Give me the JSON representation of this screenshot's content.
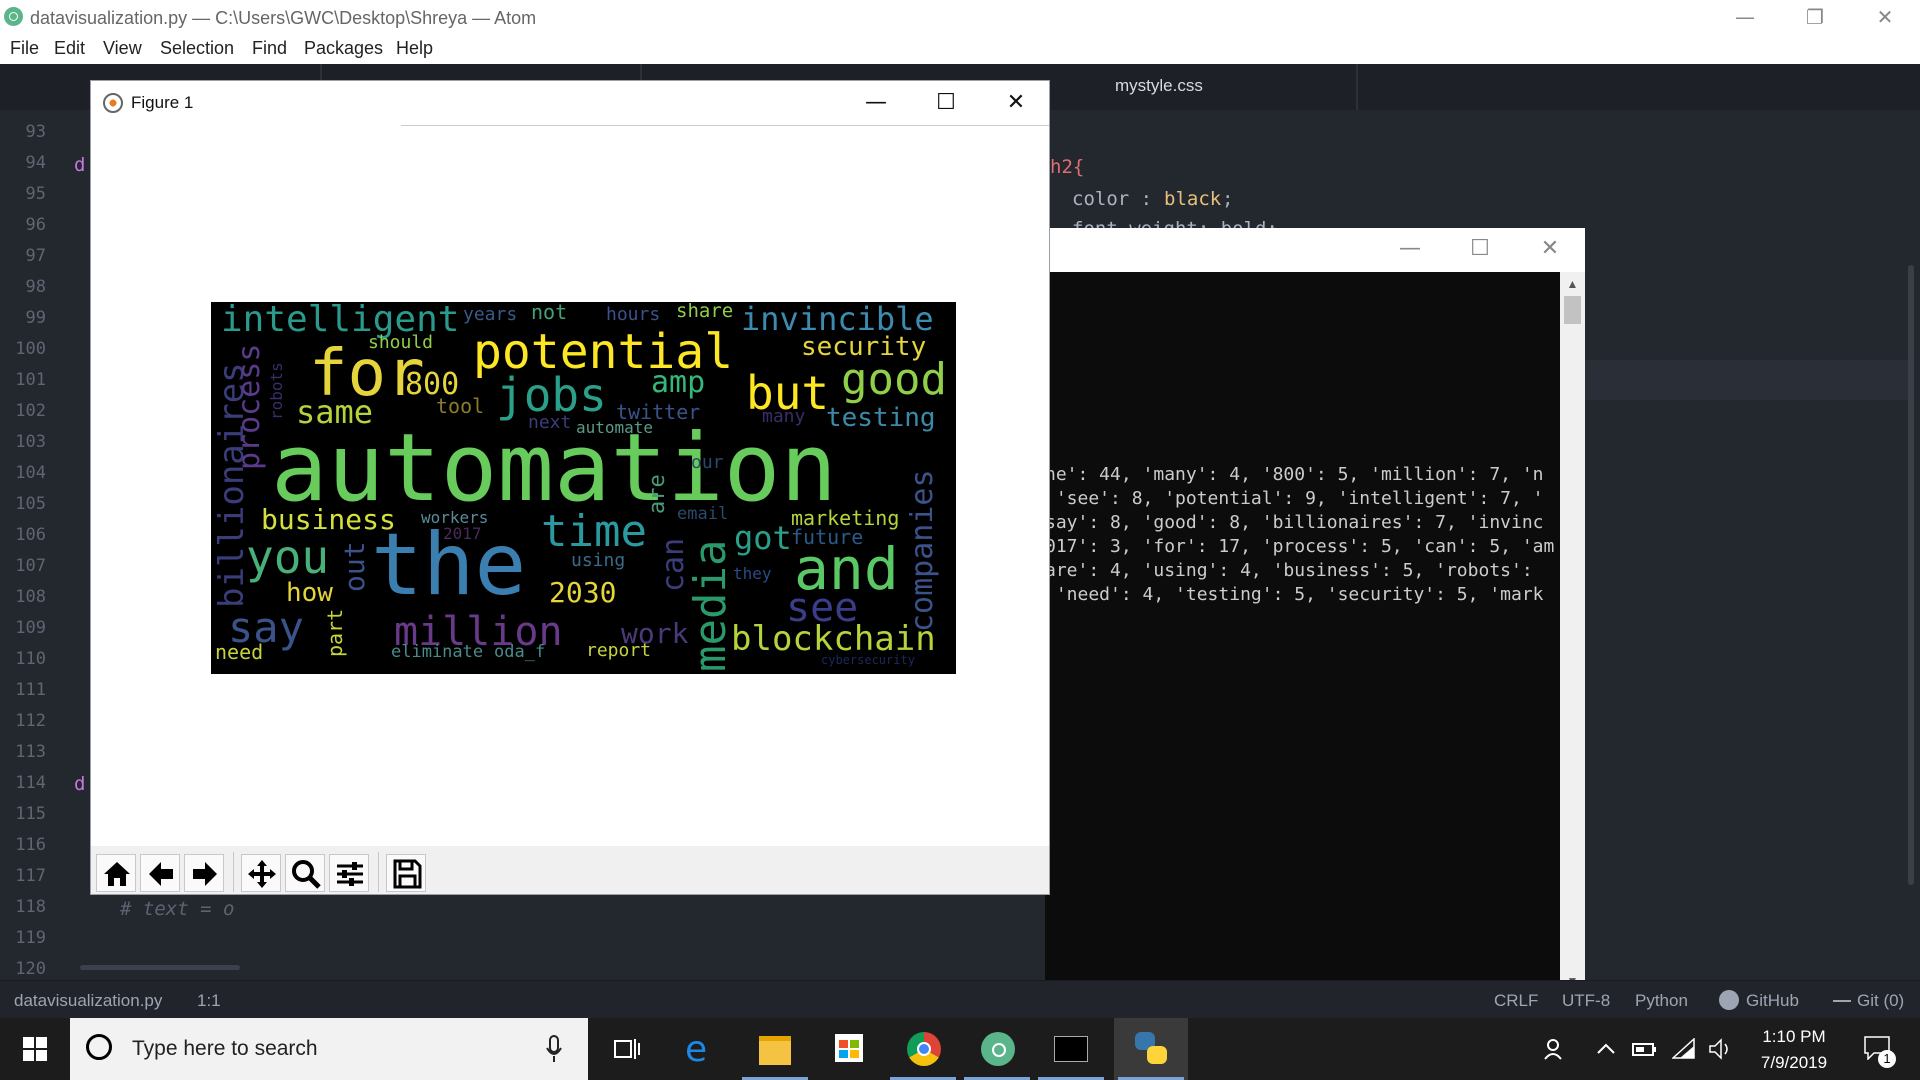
{
  "window": {
    "title": "datavisualization.py — C:\\Users\\GWC\\Desktop\\Shreya — Atom",
    "controls": {
      "minimize": "—",
      "restore": "❐",
      "close": "✕"
    }
  },
  "menu": [
    "File",
    "Edit",
    "View",
    "Selection",
    "Find",
    "Packages",
    "Help"
  ],
  "tabs": {
    "css_tab": "mystyle.css"
  },
  "editor": {
    "line_numbers": [
      "93",
      "94",
      "95",
      "96",
      "97",
      "98",
      "99",
      "100",
      "101",
      "102",
      "103",
      "104",
      "105",
      "106",
      "107",
      "108",
      "109",
      "110",
      "111",
      "112",
      "113",
      "114",
      "115",
      "116",
      "117",
      "118",
      "119",
      "120"
    ],
    "left_fragments": {
      "line94": "d",
      "line114": "d",
      "line118": "# text = o"
    },
    "right_code": {
      "line1_a": "h2{",
      "line2_a": "color : ",
      "line2_b": "black",
      "line2_c": ";",
      "line3_a": "font-weight: bold;"
    }
  },
  "console": {
    "controls": {
      "minimize": "—",
      "restore": "☐",
      "close": "✕"
    },
    "lines": [
      "he': 44, 'many': 4, '800': 5, 'million': 7, 'n",
      " 'see': 8, 'potential': 9, 'intelligent': 7, '",
      "say': 8, 'good': 8, 'billionaires': 7, 'invinc",
      "017': 3, 'for': 17, 'process': 5, 'can': 5, 'am",
      "are': 4, 'using': 4, 'business': 5, 'robots': ",
      " 'need': 4, 'testing': 5, 'security': 5, 'mark"
    ]
  },
  "figure": {
    "title": "Figure 1",
    "controls": {
      "minimize": "—",
      "maximize": "☐",
      "close": "✕"
    },
    "toolbar": [
      "home-icon",
      "back-arrow-icon",
      "forward-arrow-icon",
      "pan-icon",
      "zoom-icon",
      "subplots-icon",
      "save-icon"
    ],
    "words": [
      {
        "t": "intelligent"
      },
      {
        "t": "years"
      },
      {
        "t": "not"
      },
      {
        "t": "hours"
      },
      {
        "t": "share"
      },
      {
        "t": "invincible"
      },
      {
        "t": "should"
      },
      {
        "t": "potential"
      },
      {
        "t": "security"
      },
      {
        "t": "for"
      },
      {
        "t": "800"
      },
      {
        "t": "jobs"
      },
      {
        "t": "amp"
      },
      {
        "t": "but"
      },
      {
        "t": "good"
      },
      {
        "t": "tool"
      },
      {
        "t": "twitter"
      },
      {
        "t": "same"
      },
      {
        "t": "next"
      },
      {
        "t": "automate"
      },
      {
        "t": "many"
      },
      {
        "t": "testing"
      },
      {
        "t": "automation"
      },
      {
        "t": "our"
      },
      {
        "t": "business"
      },
      {
        "t": "workers"
      },
      {
        "t": "email"
      },
      {
        "t": "time"
      },
      {
        "t": "marketing"
      },
      {
        "t": "2017"
      },
      {
        "t": "got"
      },
      {
        "t": "future"
      },
      {
        "t": "you"
      },
      {
        "t": "the"
      },
      {
        "t": "and"
      },
      {
        "t": "using"
      },
      {
        "t": "they"
      },
      {
        "t": "how"
      },
      {
        "t": "2030"
      },
      {
        "t": "see"
      },
      {
        "t": "say"
      },
      {
        "t": "million"
      },
      {
        "t": "work"
      },
      {
        "t": "blockchain"
      },
      {
        "t": "need"
      },
      {
        "t": "eliminate"
      },
      {
        "t": "oda_f"
      },
      {
        "t": "report"
      },
      {
        "t": "cybersecurity"
      },
      {
        "t": "billionaires"
      },
      {
        "t": "process"
      },
      {
        "t": "robots"
      },
      {
        "t": "out"
      },
      {
        "t": "part"
      },
      {
        "t": "are"
      },
      {
        "t": "can"
      },
      {
        "t": "media"
      },
      {
        "t": "companies"
      }
    ]
  },
  "status_bar": {
    "file": "datavisualization.py",
    "cursor": "1:1",
    "line_ending": "CRLF",
    "encoding": "UTF-8",
    "grammar": "Python",
    "github": "GitHub",
    "git": "Git (0)"
  },
  "taskbar": {
    "search_placeholder": "Type here to search",
    "time": "1:10 PM",
    "date": "7/9/2019",
    "notifications": "1",
    "apps": [
      "task-view-icon",
      "edge-icon",
      "file-explorer-icon",
      "store-icon",
      "chrome-icon",
      "atom-icon",
      "terminal-icon",
      "python-icon"
    ]
  }
}
